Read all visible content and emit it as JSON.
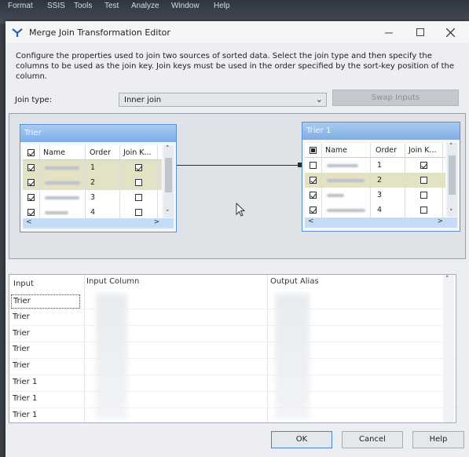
{
  "menubar": {
    "items": [
      "Format",
      "SSIS",
      "Tools",
      "Test",
      "Analyze",
      "Window",
      "Help"
    ]
  },
  "dialog": {
    "title": "Merge Join Transformation Editor",
    "description": "Configure the properties used to join two sources of sorted data. Select the join type and then specify the columns to be used as the join key. Join keys must be used in the order specified by the sort-key position of the column.",
    "join_type_label": "Join type:",
    "join_type_value": "Inner join",
    "swap_inputs_label": "Swap Inputs"
  },
  "left_input": {
    "title": "Trier",
    "columns": {
      "name": "Name",
      "order": "Order",
      "join": "Join K..."
    },
    "rows": [
      {
        "order": "1",
        "join_key": true
      },
      {
        "order": "2",
        "join_key": false
      },
      {
        "order": "3",
        "join_key": false
      },
      {
        "order": "4",
        "join_key": false
      }
    ]
  },
  "right_input": {
    "title": "Trier 1",
    "columns": {
      "name": "Name",
      "order": "Order",
      "join": "Join K..."
    },
    "rows": [
      {
        "order": "1",
        "join_key": true
      },
      {
        "order": "2",
        "join_key": false
      },
      {
        "order": "3",
        "join_key": false
      },
      {
        "order": "4",
        "join_key": false
      }
    ]
  },
  "mapping_grid": {
    "headers": {
      "input": "Input",
      "input_column": "Input Column",
      "output_alias": "Output Alias"
    },
    "inputs": [
      "Trier",
      "Trier",
      "Trier",
      "Trier",
      "Trier",
      "Trier 1",
      "Trier 1",
      "Trier 1"
    ]
  },
  "buttons": {
    "ok": "OK",
    "cancel": "Cancel",
    "help": "Help"
  },
  "colors": {
    "accent": "#4f83c9",
    "title_gradient": "#7eaee6"
  }
}
